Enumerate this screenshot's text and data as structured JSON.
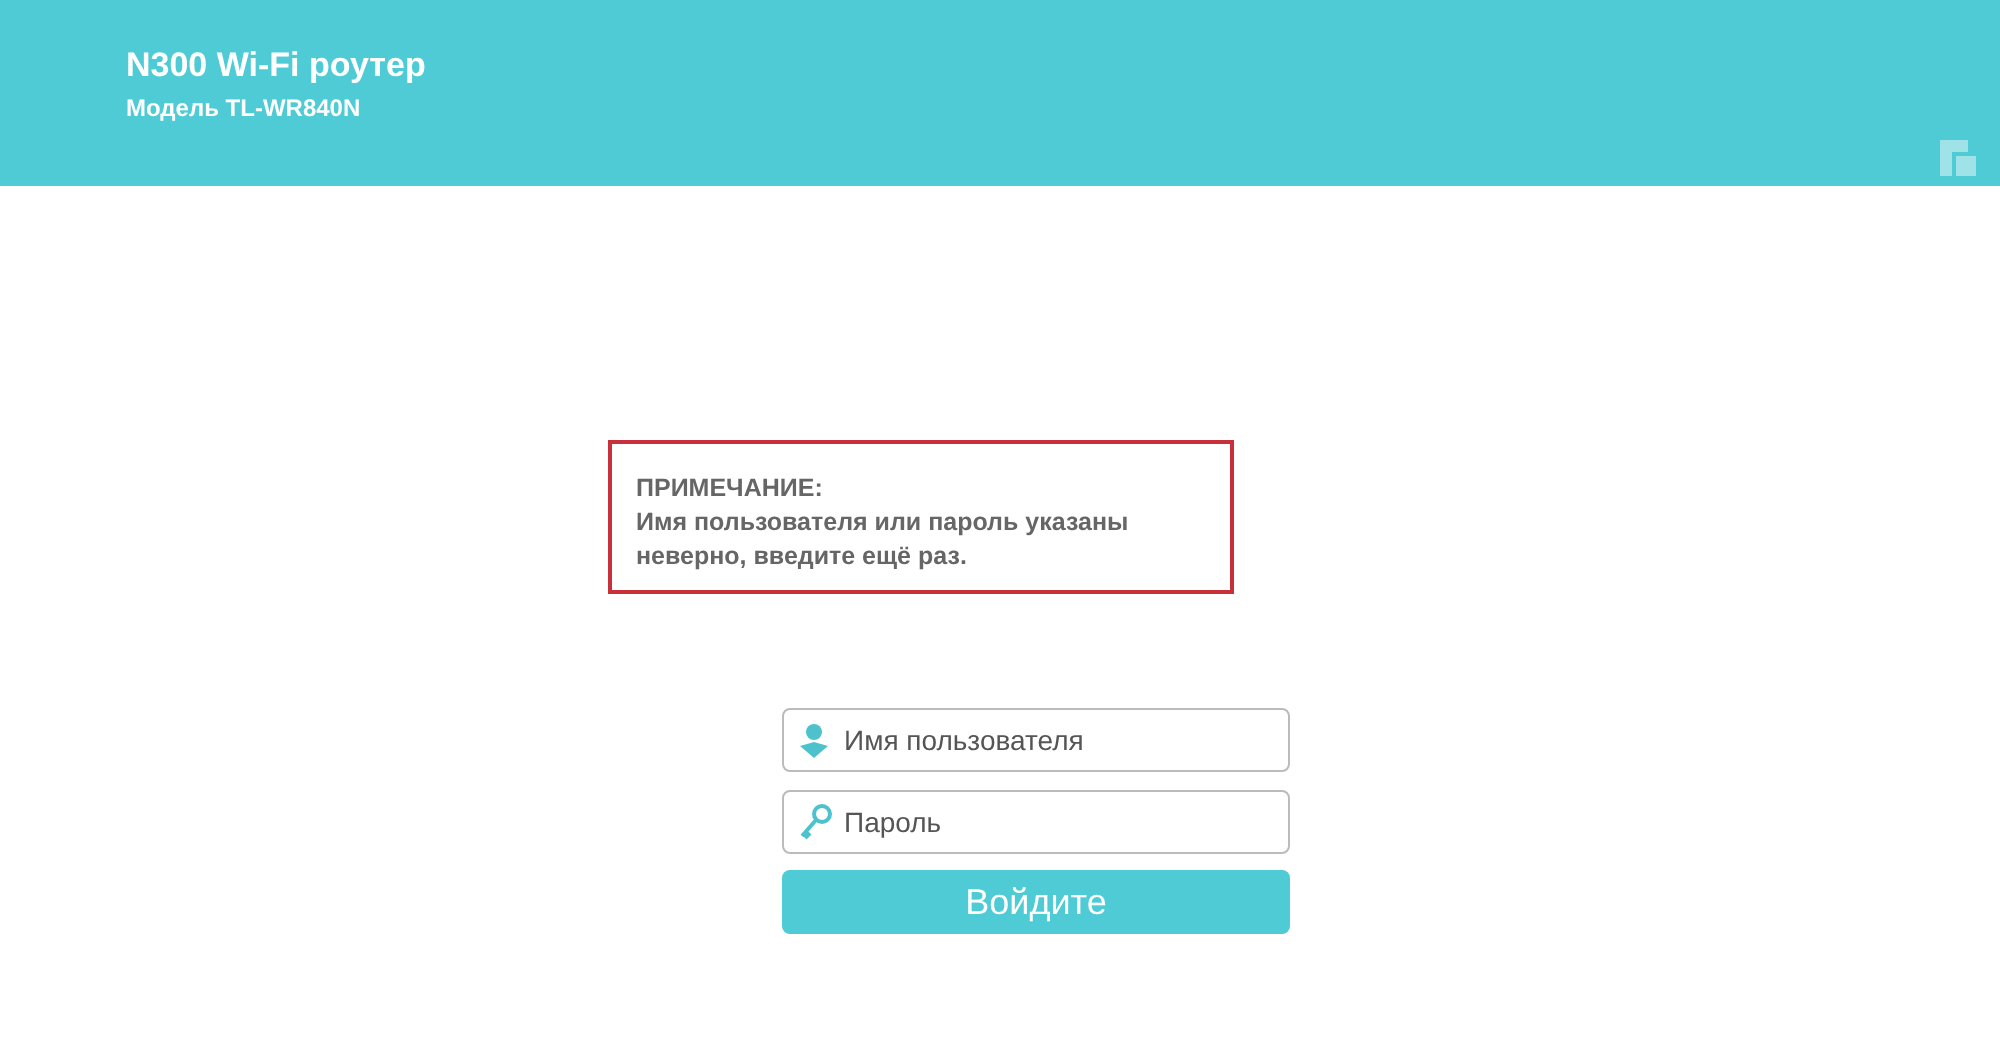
{
  "header": {
    "title": "N300 Wi-Fi роутер",
    "model": "Модель TL-WR840N"
  },
  "notice": {
    "heading": "ПРИМЕЧАНИЕ:",
    "message": "Имя пользователя или пароль указаны неверно, введите ещё раз."
  },
  "fields": [
    {
      "kind": "user",
      "placeholder": "Имя пользователя"
    },
    {
      "kind": "password",
      "placeholder": "Пароль"
    }
  ],
  "login_button": "Войдите"
}
